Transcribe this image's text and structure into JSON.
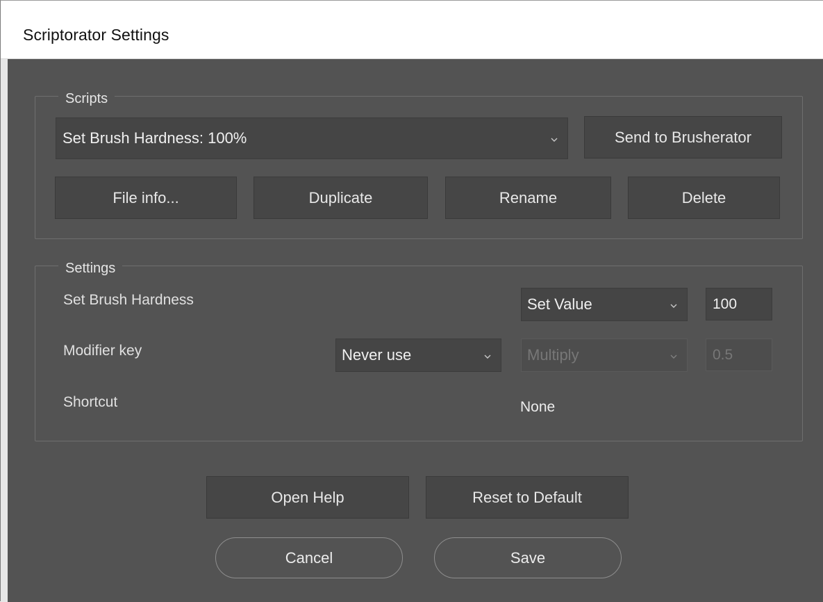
{
  "window": {
    "title": "Scriptorator Settings"
  },
  "scripts_group": {
    "label": "Scripts",
    "selected_script": "Set Brush Hardness: 100%",
    "send_button": "Send to Brusherator",
    "file_info_button": "File info...",
    "duplicate_button": "Duplicate",
    "rename_button": "Rename",
    "delete_button": "Delete"
  },
  "settings_group": {
    "label": "Settings",
    "rows": [
      {
        "label": "Set Brush Hardness",
        "mode_value": "Set Value",
        "amount_value": "100"
      },
      {
        "label": "Modifier key",
        "modifier_value": "Never use",
        "operation_value": "Multiply",
        "operation_amount": "0.5"
      },
      {
        "label": "Shortcut",
        "shortcut_value": "None"
      }
    ]
  },
  "footer": {
    "open_help_button": "Open Help",
    "reset_button": "Reset to Default",
    "cancel_button": "Cancel",
    "save_button": "Save"
  },
  "colors": {
    "panel": "#535353",
    "control": "#464646",
    "text": "#e8e8e8",
    "disabled_text": "#777777"
  },
  "icons": [
    "chevron-down-icon"
  ]
}
